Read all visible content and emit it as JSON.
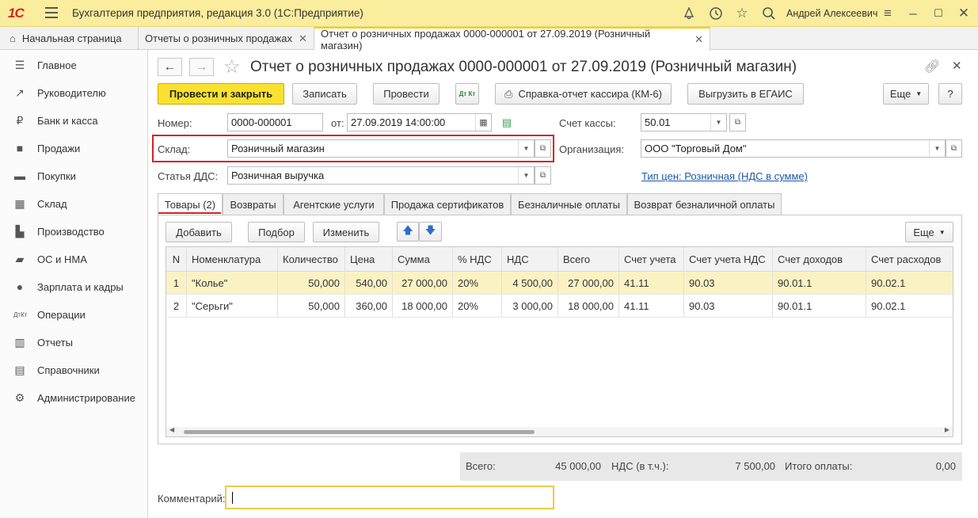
{
  "titlebar": {
    "logo": "1С",
    "app_title": "Бухгалтерия предприятия, редакция 3.0  (1С:Предприятие)",
    "user": "Андрей Алексеевич"
  },
  "window_tabs": [
    {
      "label": "Начальная страница"
    },
    {
      "label": "Отчеты о розничных продажах"
    },
    {
      "label": "Отчет о розничных продажах 0000-000001 от 27.09.2019 (Розничный магазин)"
    }
  ],
  "sidebar": {
    "items": [
      {
        "label": "Главное",
        "icon": "menu-icon"
      },
      {
        "label": "Руководителю",
        "icon": "trend-icon"
      },
      {
        "label": "Банк и касса",
        "icon": "coin-icon"
      },
      {
        "label": "Продажи",
        "icon": "bag-icon"
      },
      {
        "label": "Покупки",
        "icon": "cart-icon"
      },
      {
        "label": "Склад",
        "icon": "warehouse-icon"
      },
      {
        "label": "Производство",
        "icon": "factory-icon"
      },
      {
        "label": "ОС и НМА",
        "icon": "truck-icon"
      },
      {
        "label": "Зарплата и кадры",
        "icon": "person-icon"
      },
      {
        "label": "Операции",
        "icon": "dt-kt-icon"
      },
      {
        "label": "Отчеты",
        "icon": "bar-chart-icon"
      },
      {
        "label": "Справочники",
        "icon": "book-icon"
      },
      {
        "label": "Администрирование",
        "icon": "gear-icon"
      }
    ]
  },
  "document": {
    "title": "Отчет о розничных продажах 0000-000001 от 27.09.2019 (Розничный магазин)"
  },
  "toolbar": {
    "post_close": "Провести и закрыть",
    "save": "Записать",
    "post": "Провести",
    "dtkt": "Дт Кт",
    "cashier_report": "Справка-отчет кассира (КМ-6)",
    "egais": "Выгрузить в ЕГАИС",
    "more": "Еще",
    "help": "?"
  },
  "fields": {
    "number_label": "Номер:",
    "number_value": "0000-000001",
    "date_label": "от:",
    "date_value": "27.09.2019 14:00:00",
    "cash_account_label": "Счет кассы:",
    "cash_account_value": "50.01",
    "warehouse_label": "Склад:",
    "warehouse_value": "Розничный магазин",
    "org_label": "Организация:",
    "org_value": "ООО \"Торговый Дом\"",
    "dds_label": "Статья ДДС:",
    "dds_value": "Розничная выручка",
    "price_type_link": "Тип цен: Розничная (НДС в сумме)"
  },
  "inner_tabs": [
    {
      "label": "Товары (2)"
    },
    {
      "label": "Возвраты"
    },
    {
      "label": "Агентские услуги"
    },
    {
      "label": "Продажа сертификатов"
    },
    {
      "label": "Безналичные оплаты"
    },
    {
      "label": "Возврат безналичной оплаты"
    }
  ],
  "table_toolbar": {
    "add": "Добавить",
    "select": "Подбор",
    "edit": "Изменить",
    "more": "Еще"
  },
  "table": {
    "columns": [
      "N",
      "Номенклатура",
      "Количество",
      "Цена",
      "Сумма",
      "% НДС",
      "НДС",
      "Всего",
      "Счет учета",
      "Счет учета НДС",
      "Счет доходов",
      "Счет расходов"
    ],
    "rows": [
      [
        "1",
        "\"Колье\"",
        "50,000",
        "540,00",
        "27 000,00",
        "20%",
        "4 500,00",
        "27 000,00",
        "41.11",
        "90.03",
        "90.01.1",
        "90.02.1"
      ],
      [
        "2",
        "\"Серьги\"",
        "50,000",
        "360,00",
        "18 000,00",
        "20%",
        "3 000,00",
        "18 000,00",
        "41.11",
        "90.03",
        "90.01.1",
        "90.02.1"
      ]
    ]
  },
  "totals": {
    "total_label": "Всего:",
    "total_value": "45 000,00",
    "vat_label": "НДС (в т.ч.):",
    "vat_value": "7 500,00",
    "payment_label": "Итого оплаты:",
    "payment_value": "0,00"
  },
  "comment": {
    "label": "Комментарий:",
    "value": ""
  }
}
